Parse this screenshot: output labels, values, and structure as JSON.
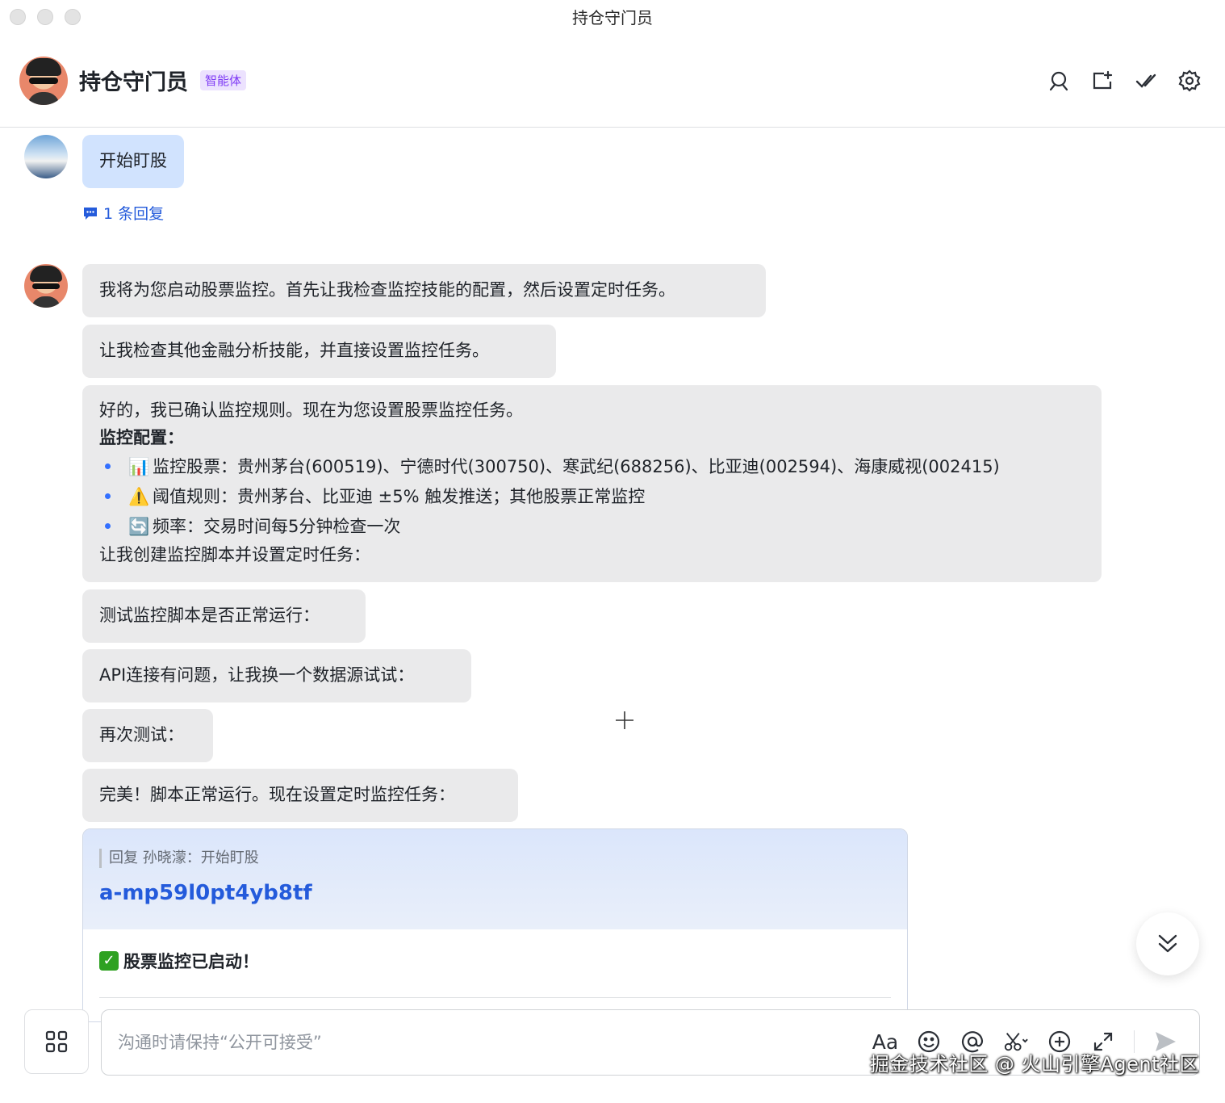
{
  "window": {
    "title": "持仓守门员"
  },
  "header": {
    "name": "持仓守门员",
    "badge": "智能体",
    "icons": [
      "search-icon",
      "new-window-icon",
      "done-check-icon",
      "settings-gear-icon"
    ]
  },
  "messages": {
    "user": {
      "text": "开始盯股",
      "reply_count": "1 条回复"
    },
    "bot1": "我将为您启动股票监控。首先让我检查监控技能的配置，然后设置定时任务。",
    "bot2": "让我检查其他金融分析技能，并直接设置监控任务。",
    "bot3": {
      "intro": "好的，我已确认监控规则。现在为您设置股票监控任务。",
      "config_title": "监控配置：",
      "items": [
        {
          "emoji": "📊",
          "text": "监控股票：贵州茅台(600519)、宁德时代(300750)、寒武纪(688256)、比亚迪(002594)、海康威视(002415)"
        },
        {
          "emoji": "⚠️",
          "text": "阈值规则：贵州茅台、比亚迪 ±5% 触发推送；其他股票正常监控"
        },
        {
          "emoji": "🔄",
          "text": "频率：交易时间每5分钟检查一次"
        }
      ],
      "outro": "让我创建监控脚本并设置定时任务："
    },
    "bot4": "测试监控脚本是否正常运行：",
    "bot5": "API连接有问题，让我换一个数据源试试：",
    "bot6": "再次测试：",
    "bot7": "完美！脚本正常运行。现在设置定时监控任务："
  },
  "card": {
    "quote": "回复 孙晓濛：开始盯股",
    "id": "a-mp59l0pt4yb8tf",
    "status": "股票监控已启动！"
  },
  "input": {
    "placeholder": "沟通时请保持“公开可接受”",
    "value": ""
  },
  "footer_watermark": "掘金技术社区 @ 火山引擎Agent社区"
}
